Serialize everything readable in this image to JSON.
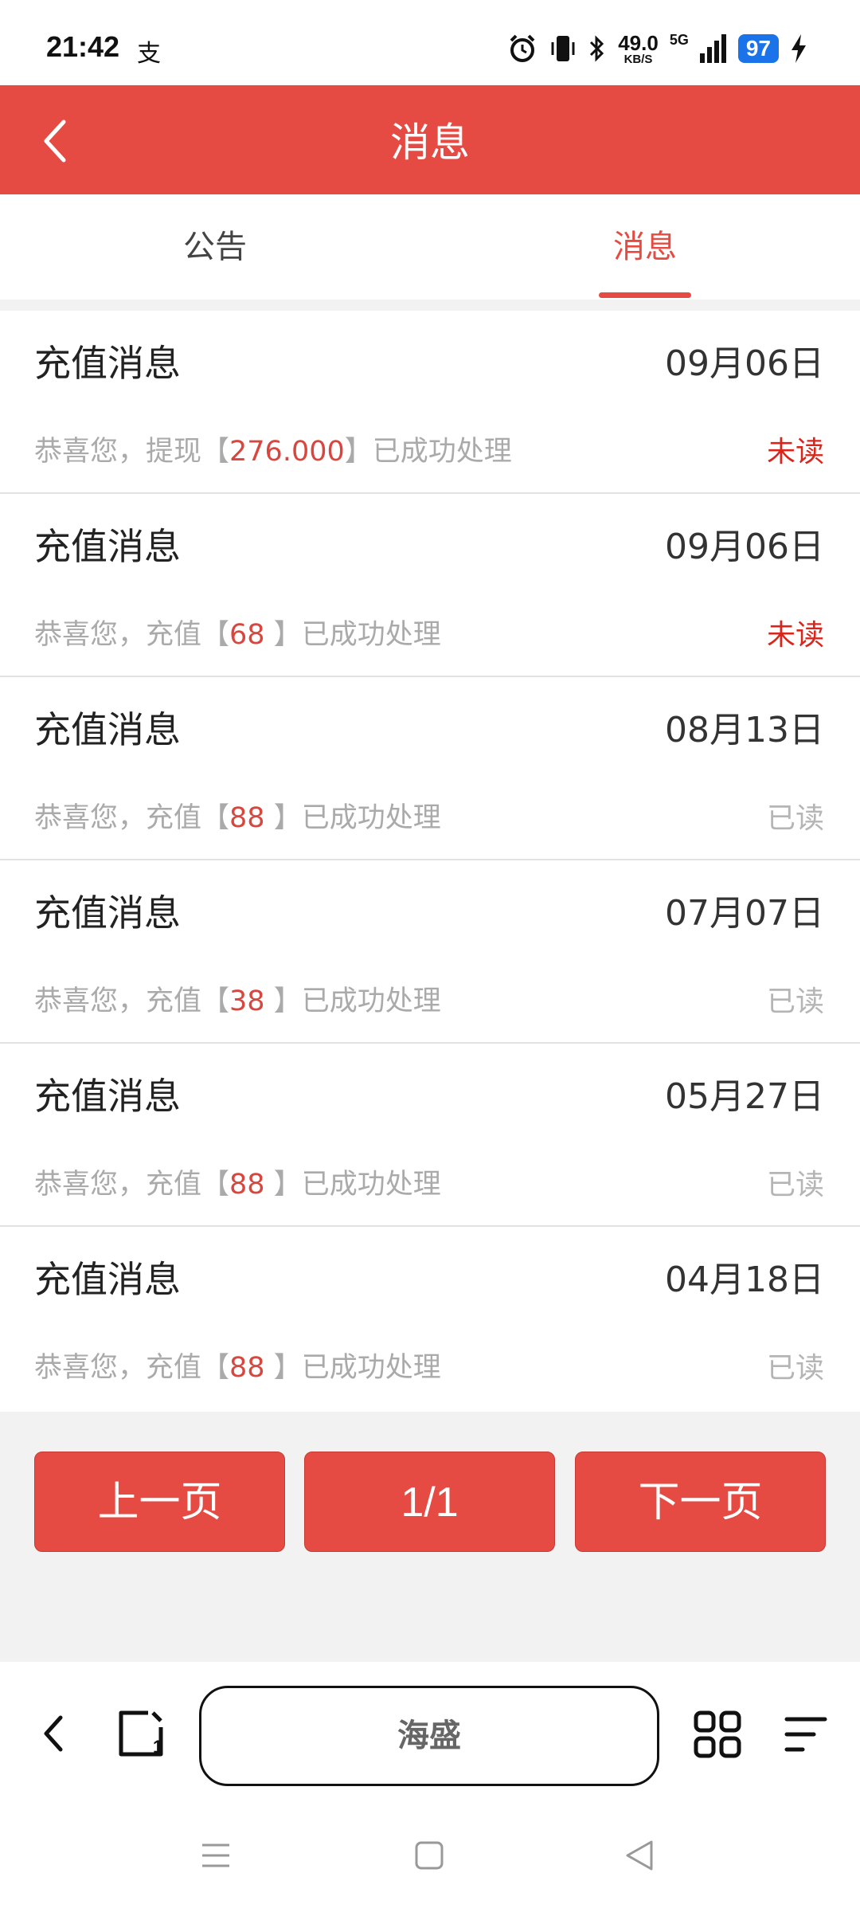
{
  "status_bar": {
    "time": "21:42",
    "alipay_glyph": "支",
    "net_speed_value": "49.0",
    "net_speed_unit": "KB/S",
    "network": "5G",
    "battery": "97",
    "icons": [
      "alarm-icon",
      "vibrate-icon",
      "bluetooth-icon",
      "signal-icon",
      "charging-icon"
    ]
  },
  "header": {
    "title": "消息"
  },
  "tabs": [
    {
      "label": "公告",
      "active": false
    },
    {
      "label": "消息",
      "active": true
    }
  ],
  "messages": [
    {
      "title": "充值消息",
      "date": "09月06日",
      "prefix": "恭喜您，提现【",
      "amount": "276.000",
      "suffix": "】已成功处理",
      "status": "未读"
    },
    {
      "title": "充值消息",
      "date": "09月06日",
      "prefix": "恭喜您，充值【",
      "amount": "68 ",
      "suffix": "】已成功处理",
      "status": "未读"
    },
    {
      "title": "充值消息",
      "date": "08月13日",
      "prefix": "恭喜您，充值【",
      "amount": "88 ",
      "suffix": "】已成功处理",
      "status": "已读"
    },
    {
      "title": "充值消息",
      "date": "07月07日",
      "prefix": "恭喜您，充值【",
      "amount": "38 ",
      "suffix": "】已成功处理",
      "status": "已读"
    },
    {
      "title": "充值消息",
      "date": "05月27日",
      "prefix": "恭喜您，充值【",
      "amount": "88 ",
      "suffix": "】已成功处理",
      "status": "已读"
    },
    {
      "title": "充值消息",
      "date": "04月18日",
      "prefix": "恭喜您，充值【",
      "amount": "88 ",
      "suffix": "】已成功处理",
      "status": "已读"
    }
  ],
  "pager": {
    "prev": "上一页",
    "page": "1/1",
    "next": "下一页"
  },
  "browser": {
    "url_label": "海盛"
  },
  "colors": {
    "accent": "#e54b43",
    "unread": "#d9261c",
    "read": "#b5b5b5"
  }
}
